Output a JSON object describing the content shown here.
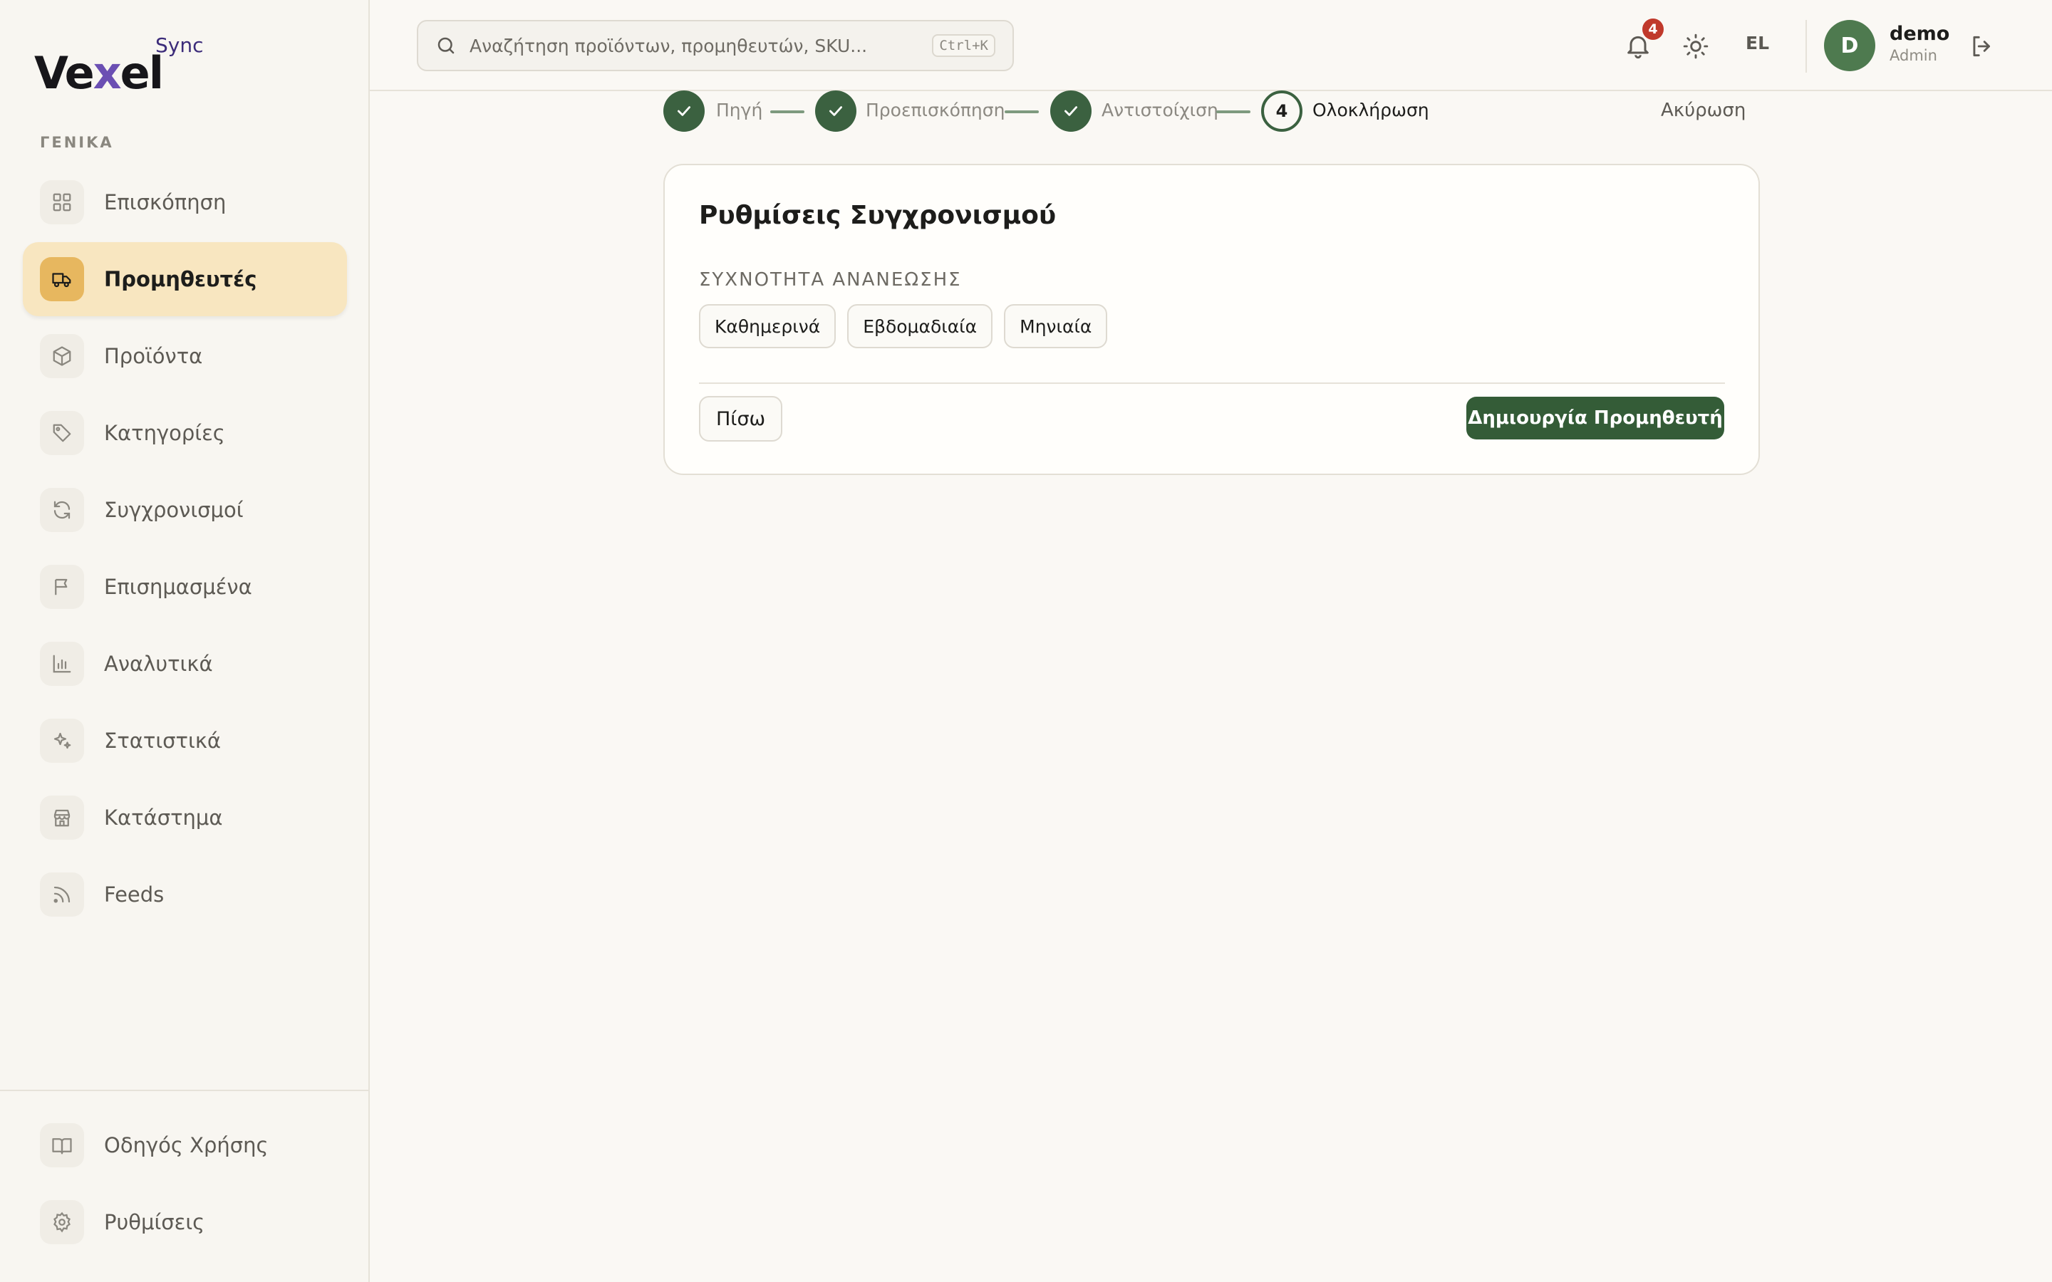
{
  "brand": {
    "name_part1": "Ve",
    "name_x": "x",
    "name_part2": "el",
    "sub": "Sync"
  },
  "sidebar": {
    "section_label": "ΓΕΝΙΚΑ",
    "items": [
      {
        "label": "Επισκόπηση",
        "icon": "grid-icon"
      },
      {
        "label": "Προμηθευτές",
        "icon": "truck-icon",
        "active": true
      },
      {
        "label": "Προϊόντα",
        "icon": "box-icon"
      },
      {
        "label": "Κατηγορίες",
        "icon": "tag-icon"
      },
      {
        "label": "Συγχρονισμοί",
        "icon": "refresh-icon"
      },
      {
        "label": "Επισημασμένα",
        "icon": "flag-icon"
      },
      {
        "label": "Αναλυτικά",
        "icon": "bar-chart-icon"
      },
      {
        "label": "Στατιστικά",
        "icon": "sparkles-icon"
      },
      {
        "label": "Κατάστημα",
        "icon": "store-icon"
      },
      {
        "label": "Feeds",
        "icon": "rss-icon"
      }
    ],
    "bottom_items": [
      {
        "label": "Οδηγός Χρήσης",
        "icon": "book-icon"
      },
      {
        "label": "Ρυθμίσεις",
        "icon": "gear-icon"
      }
    ]
  },
  "header": {
    "search_placeholder": "Αναζήτηση προϊόντων, προμηθευτών, SKU...",
    "search_shortcut": "Ctrl+K",
    "notifications_count": "4",
    "language": "EL",
    "user": {
      "initial": "D",
      "name": "demo",
      "role": "Admin"
    }
  },
  "wizard": {
    "steps": [
      {
        "label": "Πηγή",
        "status": "done"
      },
      {
        "label": "Προεπισκόπηση",
        "status": "done"
      },
      {
        "label": "Αντιστοίχιση",
        "status": "done"
      },
      {
        "label": "Ολοκλήρωση",
        "status": "current",
        "number": "4"
      }
    ],
    "cancel_label": "Ακύρωση"
  },
  "card": {
    "title": "Ρυθμίσεις Συγχρονισμού",
    "frequency_label": "ΣΥΧΝΟΤΗΤΑ ΑΝΑΝΕΩΣΗΣ",
    "frequency_options": [
      "Καθημερινά",
      "Εβδομαδιαία",
      "Μηνιαία"
    ],
    "back_label": "Πίσω",
    "submit_label": "Δημιουργία Προμηθευτή"
  },
  "colors": {
    "accent_green": "#345c37",
    "active_nav_bg": "#f8e6c0",
    "active_nav_icon_bg": "#e7b75f",
    "badge_red": "#c0392b"
  }
}
